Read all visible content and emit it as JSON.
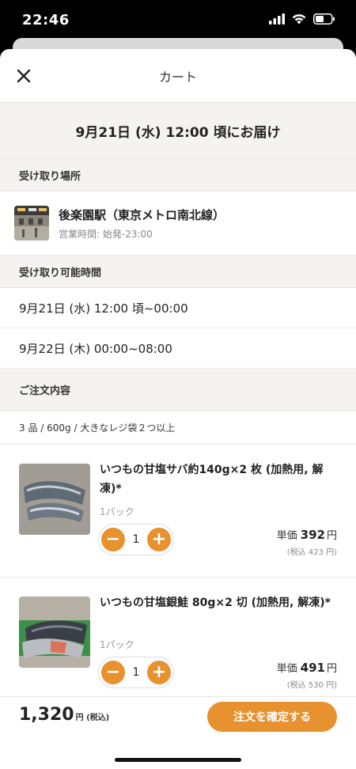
{
  "status_bar": {
    "time": "22:46",
    "icons": [
      "signal-icon",
      "wifi-icon",
      "battery-icon"
    ]
  },
  "header": {
    "title": "カート",
    "close_icon": "close-icon"
  },
  "delivery": {
    "text": "9月21日 (水) 12:00 頃にお届け"
  },
  "pickup": {
    "section_label": "受け取り場所",
    "name": "後楽園駅（東京メトロ南北線）",
    "hours": "営業時間: 始発-23:00"
  },
  "time_slots": {
    "section_label": "受け取り可能時間",
    "slots": [
      "9月21日 (水) 12:00 頃~00:00",
      "9月22日 (木) 00:00~08:00"
    ]
  },
  "order": {
    "section_label": "ご注文内容",
    "summary": "3 品 / 600g / 大きなレジ袋２つ以上",
    "items": [
      {
        "name": "いつもの甘塩サバ約140g×2 枚 (加熱用, 解凍)*",
        "unit": "1パック",
        "qty": "1",
        "price_label": "単価",
        "price": "392",
        "currency": "円",
        "tax_incl": "(税込 423 円)"
      },
      {
        "name": "いつもの甘塩銀鮭 80g×2 切 (加熱用, 解凍)*",
        "unit": "1パック",
        "qty": "1",
        "price_label": "単価",
        "price": "491",
        "currency": "円",
        "tax_incl": "(税込 530 円)"
      }
    ]
  },
  "footer": {
    "total": "1,320",
    "total_suffix": "円 (税込)",
    "checkout_label": "注文を確定する"
  },
  "colors": {
    "accent": "#e8912f",
    "section_bg": "#f4f3f1"
  }
}
